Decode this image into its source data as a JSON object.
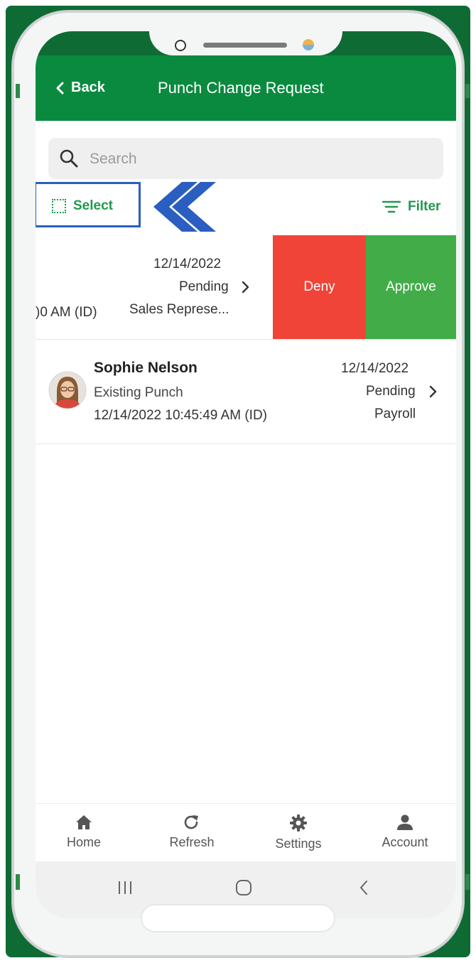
{
  "header": {
    "back_label": "Back",
    "title": "Punch Change Request"
  },
  "search": {
    "placeholder": "Search"
  },
  "toolbar": {
    "select_label": "Select",
    "filter_label": "Filter"
  },
  "row1": {
    "time_partial": ")0 AM (ID)",
    "date": "12/14/2022",
    "status": "Pending",
    "department": "Sales Represe...",
    "deny_label": "Deny",
    "approve_label": "Approve"
  },
  "row2": {
    "name": "Sophie Nelson",
    "punch_type": "Existing Punch",
    "timestamp": "12/14/2022 10:45:49 AM (ID)",
    "date": "12/14/2022",
    "status": "Pending",
    "department": "Payroll"
  },
  "bottom_nav": {
    "home": "Home",
    "refresh": "Refresh",
    "settings": "Settings",
    "account": "Account"
  },
  "colors": {
    "header_green": "#0a8a3f",
    "accent_green": "#1f9a4d",
    "deny_red": "#f04438",
    "approve_green": "#42ad48",
    "highlight_blue": "#2a5ec0"
  },
  "icons": {
    "back": "chevron-left-icon",
    "search": "search-icon",
    "select": "dotted-square-icon",
    "filter": "filter-icon",
    "row_chevron": "chevron-right-icon",
    "home": "home-icon",
    "refresh": "refresh-icon",
    "settings": "gear-icon",
    "account": "person-icon",
    "sys_recents": "recents-icon",
    "sys_home": "home-circle-icon",
    "sys_back": "back-icon",
    "annotation": "double-chevron-left-icon"
  }
}
